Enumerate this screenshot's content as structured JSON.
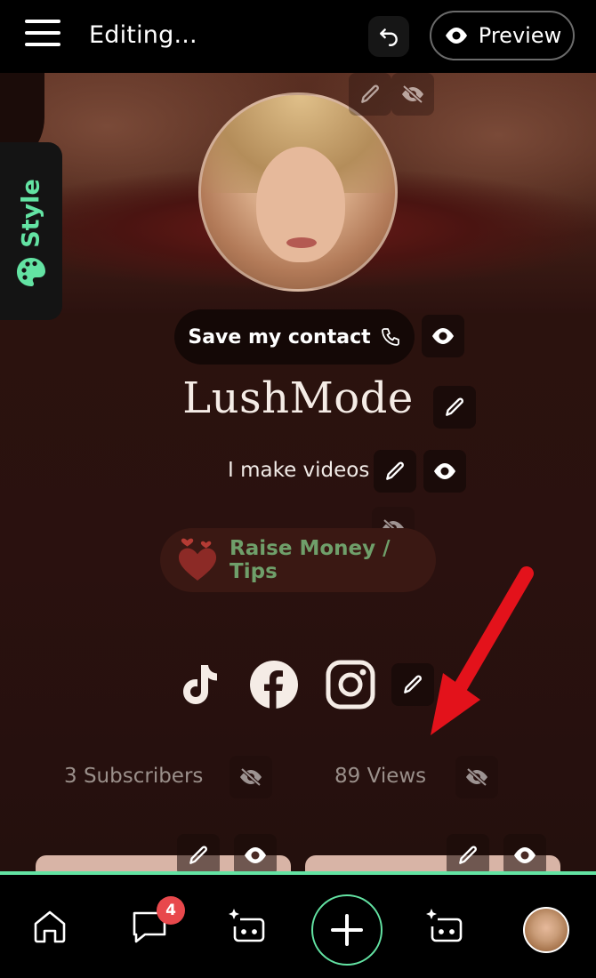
{
  "header": {
    "title": "Editing...",
    "preview_label": "Preview"
  },
  "style_tab": {
    "label": "Style"
  },
  "profile": {
    "contact_label": "Save my contact",
    "name": "LushMode",
    "bio": "I make videos"
  },
  "tips": {
    "label": "Raise Money / Tips"
  },
  "socials": [
    "tiktok-icon",
    "facebook-icon",
    "instagram-icon"
  ],
  "stats": {
    "subscribers_count": "3",
    "subscribers_label": "Subscribers",
    "views_count": "89",
    "views_label": "Views"
  },
  "nav": {
    "messages_badge": "4"
  },
  "colors": {
    "accent": "#63e3a3",
    "background": "#2a110f",
    "tips_text": "#6f9f6a",
    "badge": "#e8484c",
    "arrow": "#e3121b"
  }
}
